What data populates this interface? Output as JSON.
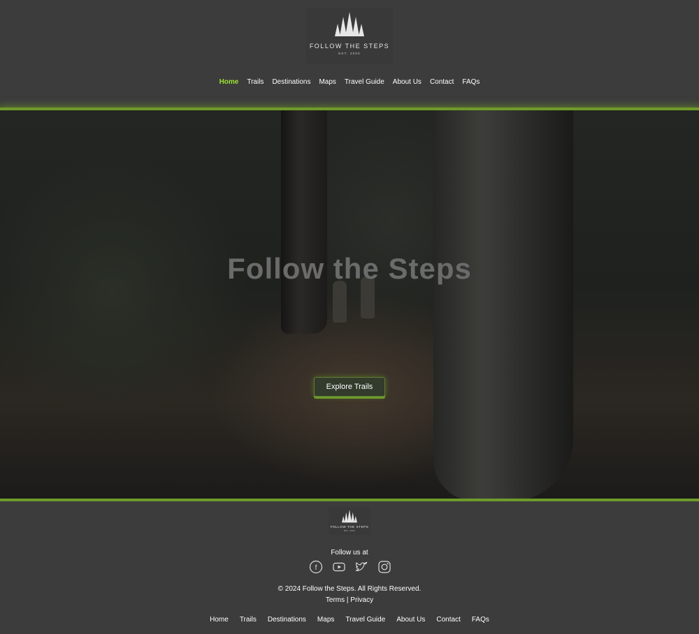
{
  "brand": {
    "name": "FOLLOW THE STEPS",
    "est": "EST. 2000"
  },
  "nav": [
    {
      "label": "Home",
      "active": true
    },
    {
      "label": "Trails"
    },
    {
      "label": "Destinations"
    },
    {
      "label": "Maps"
    },
    {
      "label": "Travel Guide"
    },
    {
      "label": "About Us"
    },
    {
      "label": "Contact"
    },
    {
      "label": "FAQs"
    }
  ],
  "hero": {
    "title": "Follow the Steps",
    "cta": "Explore Trails"
  },
  "footer": {
    "follow_label": "Follow us at",
    "socials": [
      "facebook-icon",
      "youtube-icon",
      "twitter-icon",
      "instagram-icon"
    ],
    "copyright": "© 2024 Follow the Steps. All Rights Reserved.",
    "terms": "Terms",
    "separator": "|",
    "privacy": "Privacy"
  },
  "colors": {
    "accent": "#9ee233",
    "background": "#3c3c3c",
    "glow": "#6f9b2a"
  }
}
